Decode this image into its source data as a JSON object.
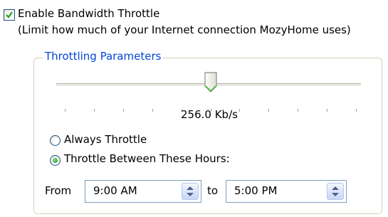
{
  "throttle": {
    "enabled": true,
    "label": "Enable Bandwidth Throttle",
    "description": "(Limit how much of your Internet connection MozyHome uses)"
  },
  "parameters": {
    "title": "Throttling Parameters",
    "slider": {
      "position_fraction": 0.5,
      "tick_count": 11,
      "value_label": "256.0 Kb/s"
    },
    "modes": [
      {
        "label": "Always Throttle",
        "selected": false
      },
      {
        "label": "Throttle Between These Hours:",
        "selected": true
      }
    ],
    "hours": {
      "from_label": "From",
      "from_value": "9:00 AM",
      "to_label": "to",
      "to_value": "5:00 PM"
    }
  },
  "colors": {
    "group_title": "#0046d5",
    "radio_selected": "#21a121",
    "checkmark": "#21a121"
  }
}
